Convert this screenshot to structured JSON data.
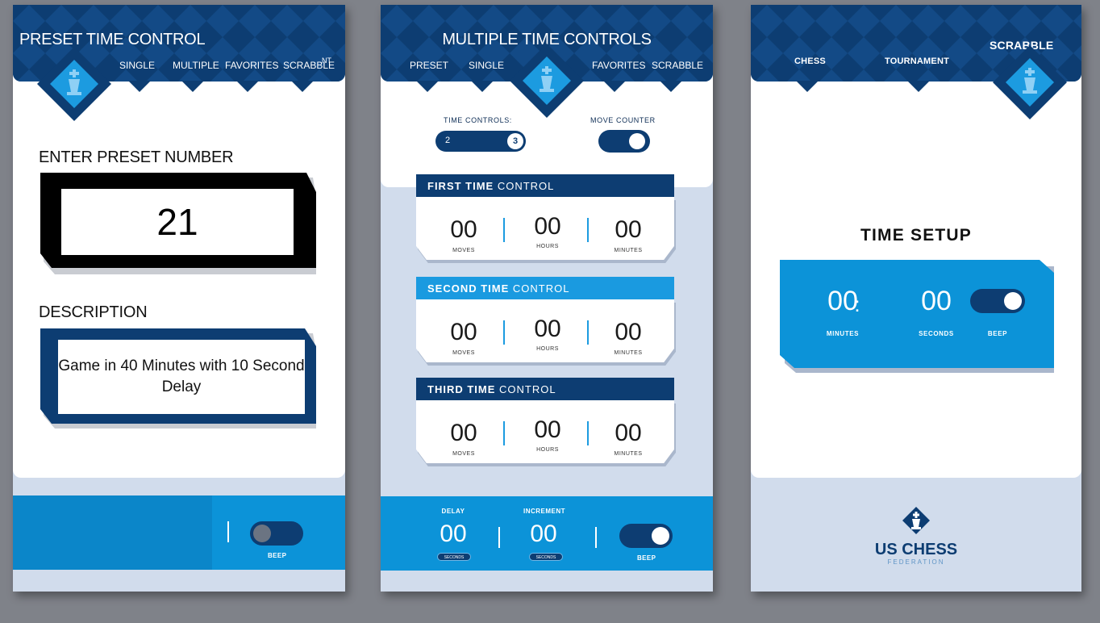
{
  "colors": {
    "navy": "#0d3d72",
    "blue": "#0c93d8",
    "light": "#d1dcec",
    "bg": "#7f8289"
  },
  "panel1": {
    "title": "PRESET TIME CONTROL",
    "nav": [
      "SINGLE",
      "MULTIPLE",
      "FAVORITES",
      "SCRABBLE"
    ],
    "nav_overflow": "NT",
    "preset_label": "ENTER PRESET NUMBER",
    "preset_value": "21",
    "description_label": "DESCRIPTION",
    "description_value": "Game in 40 Minutes with 10 Second Delay",
    "beep_label": "BEEP",
    "beep_on": false
  },
  "panel2": {
    "title": "MULTIPLE TIME CONTROLS",
    "nav": [
      "PRESET",
      "SINGLE",
      "FAVORITES",
      "SCRABBLE"
    ],
    "time_controls_label": "TIME CONTROLS:",
    "time_controls_options": [
      "2",
      "3"
    ],
    "time_controls_selected": "3",
    "move_counter_label": "MOVE COUNTER",
    "move_counter_on": true,
    "controls": [
      {
        "title_bold": "FIRST TIME",
        "title_rest": "CONTROL",
        "values": [
          "00",
          "00",
          "00"
        ],
        "labels": [
          "MOVES",
          "HOURS",
          "MINUTES"
        ]
      },
      {
        "title_bold": "SECOND TIME",
        "title_rest": "CONTROL",
        "values": [
          "00",
          "00",
          "00"
        ],
        "labels": [
          "MOVES",
          "HOURS",
          "MINUTES"
        ]
      },
      {
        "title_bold": "THIRD TIME",
        "title_rest": "CONTROL",
        "values": [
          "00",
          "00",
          "00"
        ],
        "labels": [
          "MOVES",
          "HOURS",
          "MINUTES"
        ]
      }
    ],
    "delay_label": "DELAY",
    "delay_value": "00",
    "delay_unit": "SECONDS",
    "increment_label": "INCREMENT",
    "increment_value": "00",
    "increment_unit": "SECONDS",
    "beep_label": "BEEP",
    "beep_on": true
  },
  "panel3": {
    "nav": [
      "CHESS",
      "TOURNAMENT",
      "SCRABBLE"
    ],
    "title": "TIME SETUP",
    "minutes_value": "00",
    "seconds_value": "00",
    "separator": ":",
    "minutes_label": "MINUTES",
    "seconds_label": "SECONDS",
    "beep_label": "BEEP",
    "beep_on": true,
    "logo_line1": "US CHESS",
    "logo_line2": "FEDERATION"
  }
}
